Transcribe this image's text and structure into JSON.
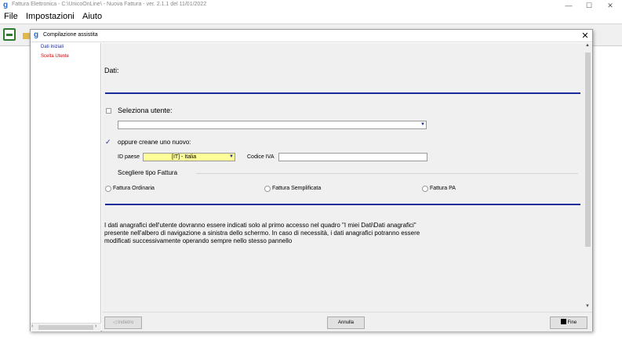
{
  "app": {
    "title": "Fattura Elettronica - C:\\UnicoOnLine\\ - Nuova Fattura -       ver. 2.1.1 del 11/01/2022",
    "icon": "app-logo-icon",
    "controls": {
      "minimize": "—",
      "maximize": "☐",
      "close": "✕"
    }
  },
  "menu": {
    "items": [
      "File",
      "Impostazioni",
      "Aiuto"
    ]
  },
  "toolbar": {
    "buttons": [
      "new-document-icon",
      "folder-icon"
    ]
  },
  "dialog": {
    "title": "Compilazione assistita",
    "close": "✕",
    "nav": {
      "items": [
        {
          "label": "Dati Iniziali",
          "color": "#1a2b9a"
        },
        {
          "label": "Scelta Utente",
          "color": "#e00000"
        }
      ]
    },
    "form": {
      "section_title": "Dati:",
      "select_user_label": "Seleziona utente:",
      "select_user_checked": false,
      "user_combo_value": "",
      "create_new_label": "oppure creane uno nuovo:",
      "create_new_checked": true,
      "id_paese_label": "ID paese",
      "id_paese_value": "[IT] - Italia",
      "codice_iva_label": "Codice IVA",
      "codice_iva_value": "",
      "tipo_fattura_label": "Scegliere tipo Fattura",
      "tipo_options": [
        "Fattura Ordinaria",
        "Fattura Semplificata",
        "Fattura PA"
      ],
      "info_lines": [
        "I dati anagrafici dell'utente dovranno essere indicati solo al primo accesso nel quadro \"I miei Dati\\Dati anagrafici\"",
        "presente nell'albero di navigazione a sinistra dello schermo. In caso di necessità, i dati anagrafici potranno essere",
        "modificati successivamente operando sempre nello stesso pannello"
      ]
    },
    "footer": {
      "back": "Indietro",
      "cancel": "Annulla",
      "finish": "Fine"
    }
  },
  "colors": {
    "accent_blue": "#1a2b9a",
    "highlight_yellow": "#ffff99",
    "alert_red": "#e00000"
  }
}
